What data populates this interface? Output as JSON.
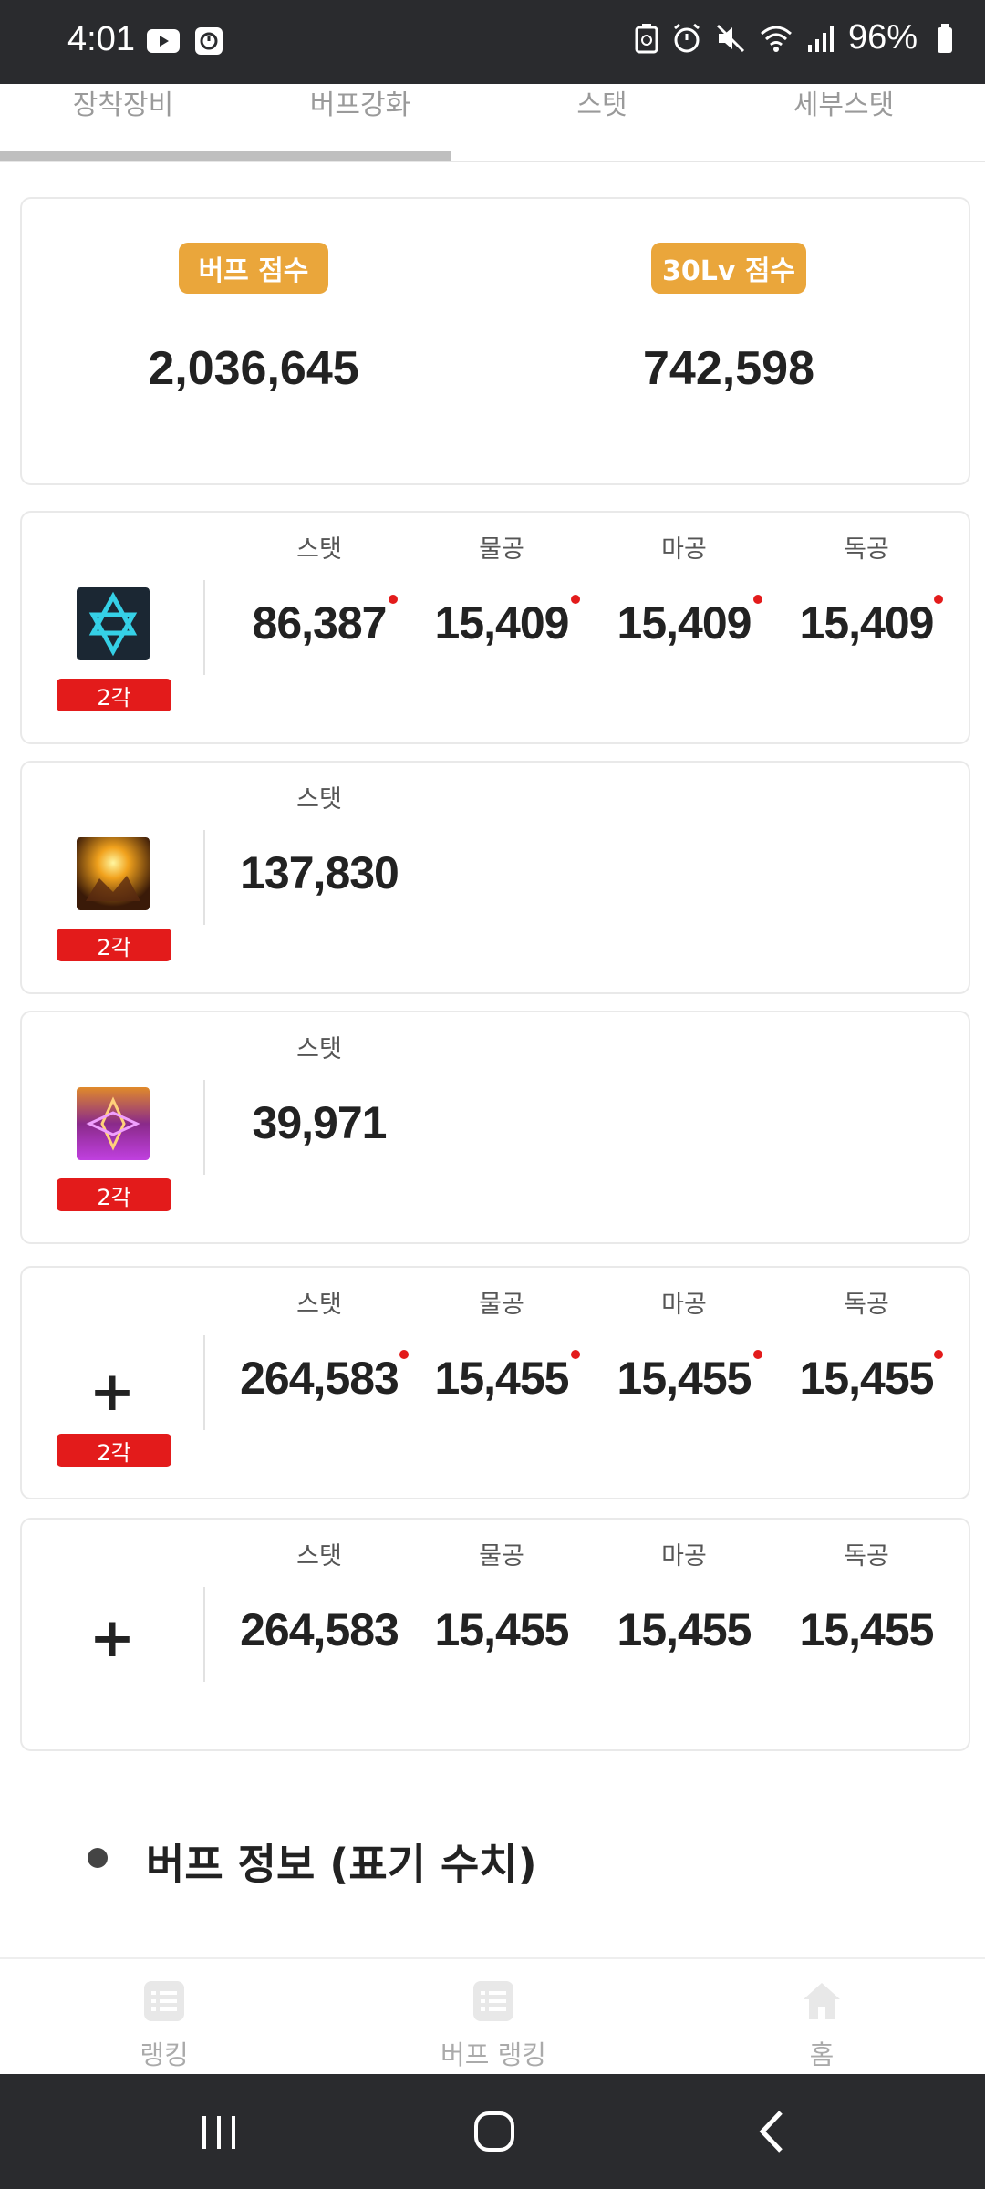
{
  "status_bar": {
    "time": "4:01",
    "battery": "96%"
  },
  "tabs": [
    {
      "label": "장착장비"
    },
    {
      "label": "버프강화"
    },
    {
      "label": "스탯"
    },
    {
      "label": "세부스탯"
    }
  ],
  "scores": {
    "buff": {
      "label": "버프 점수",
      "value": "2,036,645"
    },
    "lv30": {
      "label": "30Lv 점수",
      "value": "742,598"
    }
  },
  "buff_rows": [
    {
      "icon": "hexagram-skill-icon",
      "rank": "2각",
      "stats": [
        {
          "label": "스탯",
          "value": "86,387",
          "marked": true
        },
        {
          "label": "물공",
          "value": "15,409",
          "marked": true
        },
        {
          "label": "마공",
          "value": "15,409",
          "marked": true
        },
        {
          "label": "독공",
          "value": "15,409",
          "marked": true
        }
      ]
    },
    {
      "icon": "golden-burst-skill-icon",
      "rank": "2각",
      "stats": [
        {
          "label": "스탯",
          "value": "137,830",
          "marked": false
        }
      ]
    },
    {
      "icon": "purple-aura-skill-icon",
      "rank": "2각",
      "stats": [
        {
          "label": "스탯",
          "value": "39,971",
          "marked": false
        }
      ]
    },
    {
      "icon": "plus-icon",
      "symbol": "+",
      "rank": "2각",
      "stats": [
        {
          "label": "스탯",
          "value": "264,583",
          "marked": true
        },
        {
          "label": "물공",
          "value": "15,455",
          "marked": true
        },
        {
          "label": "마공",
          "value": "15,455",
          "marked": true
        },
        {
          "label": "독공",
          "value": "15,455",
          "marked": true
        }
      ]
    },
    {
      "icon": "plus-icon",
      "symbol": "+",
      "stats": [
        {
          "label": "스탯",
          "value": "264,583",
          "marked": false
        },
        {
          "label": "물공",
          "value": "15,455",
          "marked": false
        },
        {
          "label": "마공",
          "value": "15,455",
          "marked": false
        },
        {
          "label": "독공",
          "value": "15,455",
          "marked": false
        }
      ]
    }
  ],
  "section": {
    "title": "버프 정보 (표기 수치)"
  },
  "bottom_nav": [
    {
      "label": "랭킹",
      "icon": "list-icon"
    },
    {
      "label": "버프 랭킹",
      "icon": "list-icon"
    },
    {
      "label": "홈",
      "icon": "home-icon"
    }
  ],
  "colors": {
    "accent": "#eaa63b",
    "rank_badge": "#e31b1b",
    "marker_dot": "#e31b1b"
  }
}
